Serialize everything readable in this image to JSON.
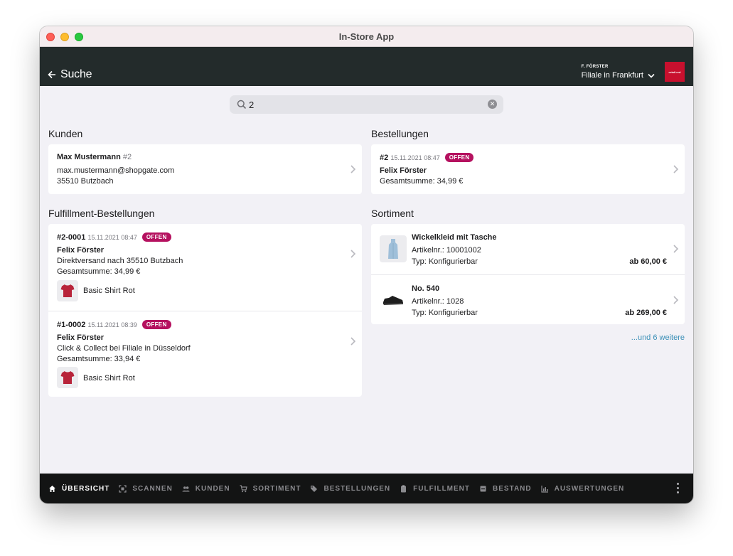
{
  "window": {
    "title": "In-Store App"
  },
  "header": {
    "back_label": "Suche",
    "user": "F. FÖRSTER",
    "store": "Filiale in Frankfurt",
    "brand": "retail.red"
  },
  "search": {
    "value": "2",
    "placeholder": ""
  },
  "customers": {
    "title": "Kunden",
    "items": [
      {
        "name": "Max Mustermann",
        "id": "#2",
        "email": "max.mustermann@shopgate.com",
        "address": "35510 Butzbach"
      }
    ]
  },
  "orders": {
    "title": "Bestellungen",
    "items": [
      {
        "number": "#2",
        "date": "15.11.2021 08:47",
        "status": "OFFEN",
        "customer": "Felix Förster",
        "total": "Gesamtsumme: 34,99 €"
      }
    ]
  },
  "fulfillment": {
    "title": "Fulfillment-Bestellungen",
    "items": [
      {
        "number": "#2-0001",
        "date": "15.11.2021 08:47",
        "status": "OFFEN",
        "customer": "Felix Förster",
        "method": "Direktversand nach 35510 Butzbach",
        "total": "Gesamtsumme: 34,99 €",
        "product": "Basic Shirt Rot"
      },
      {
        "number": "#1-0002",
        "date": "15.11.2021 08:39",
        "status": "OFFEN",
        "customer": "Felix Förster",
        "method": "Click & Collect bei Filiale in Düsseldorf",
        "total": "Gesamtsumme: 33,94 €",
        "product": "Basic Shirt Rot"
      }
    ]
  },
  "catalog": {
    "title": "Sortiment",
    "items": [
      {
        "name": "Wickelkleid mit Tasche",
        "sku": "Artikelnr.: 10001002",
        "type": "Typ: Konfigurierbar",
        "price": "ab 60,00 €"
      },
      {
        "name": "No. 540",
        "sku": "Artikelnr.: 1028",
        "type": "Typ: Konfigurierbar",
        "price": "ab 269,00 €"
      }
    ],
    "more_label": "...und 6 weitere"
  },
  "tabs": [
    {
      "label": "ÜBERSICHT",
      "icon": "home-icon",
      "active": true
    },
    {
      "label": "SCANNEN",
      "icon": "scan-icon",
      "active": false
    },
    {
      "label": "KUNDEN",
      "icon": "people-icon",
      "active": false
    },
    {
      "label": "SORTIMENT",
      "icon": "cart-icon",
      "active": false
    },
    {
      "label": "BESTELLUNGEN",
      "icon": "tag-icon",
      "active": false
    },
    {
      "label": "FULFILLMENT",
      "icon": "clipboard-icon",
      "active": false
    },
    {
      "label": "BESTAND",
      "icon": "inventory-icon",
      "active": false
    },
    {
      "label": "AUSWERTUNGEN",
      "icon": "bar-chart-icon",
      "active": false
    }
  ],
  "colors": {
    "badge": "#b5115f",
    "appbar": "#232b2b",
    "tabbar": "#131414",
    "link": "#3a8fb7",
    "brand": "#c8102e"
  }
}
